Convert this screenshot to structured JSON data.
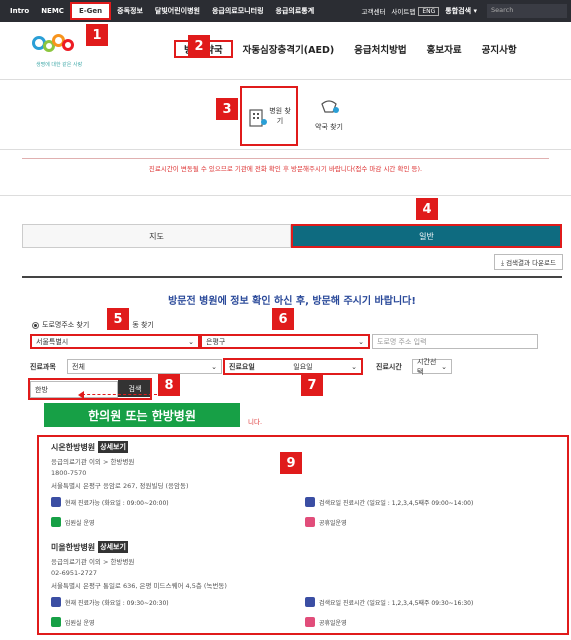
{
  "topbar": {
    "items": [
      "Intro",
      "NEMC",
      "E-Gen",
      "중독정보",
      "달빛어린이병원",
      "응급의료모니터링",
      "응급의료통계"
    ],
    "right": [
      "고객센터",
      "사이트맵"
    ],
    "lang": "ENG",
    "integrated_search": "통합검색 ▾",
    "search_placeholder": "Search"
  },
  "logo": {
    "slogan": "생명에 대한 같은 사랑"
  },
  "nav": {
    "items": [
      "병원.약국",
      "자동심장충격기(AED)",
      "응급처치방법",
      "홍보자료",
      "공지사항"
    ]
  },
  "subtabs": {
    "hospital": "병원 찾기",
    "pharmacy": "약국 찾기"
  },
  "notice": "진료시간이 변동될 수 있으므로 기관에 전화 확인 후 방문해주시기 바랍니다(접수 마감 시간 확인 등).",
  "viewtabs": {
    "map": "지도",
    "general": "일반"
  },
  "download": "⤓ 검색결과 다운로드",
  "filter": {
    "headline": "방문전 병원에 정보 확인 하신 후, 방문해 주시기 바랍니다!",
    "radio_road": "도로명주소 찾기",
    "radio_dong": "동 찾기",
    "city": "서울특별시",
    "district": "은평구",
    "road_placeholder": "도로명 주소 입력",
    "dept_label": "진료과목",
    "dept_value": "전체",
    "day_label": "진료요일",
    "day_value": "일요일",
    "time_label": "진료시간",
    "time_value": "시간선택",
    "keyword": "한방",
    "search_btn": "검색"
  },
  "annotation": {
    "green": "한의원 또는 한방병원",
    "result_note": "니다."
  },
  "badges": [
    "1",
    "2",
    "3",
    "4",
    "5",
    "6",
    "7",
    "8",
    "9"
  ],
  "results": [
    {
      "name": "시온한방병원",
      "detail": "상세보기",
      "type": "응급의료기관 이외 > 한방병원",
      "phone": "1800-7570",
      "address": "서울특별시 은평구 응암로 267, 정원빌딩 (응암동)",
      "status_now": "현재 진료가능 (화요일 : 09:00~20:00)",
      "status_search": "검색요일 진료시간 (일요일 : 1,2,3,4,5째주 09:00~14:00)",
      "er": "입원실 운영",
      "holiday": "공휴일운영"
    },
    {
      "name": "미올한방병원",
      "detail": "상세보기",
      "type": "응급의료기관 이외 > 한방병원",
      "phone": "02-6951-2727",
      "address": "서울특별시 은평구 통일로 636, 은평 미드스퀘어 4,5층 (녹번동)",
      "status_now": "현재 진료가능 (화요일 : 09:30~20:30)",
      "status_search": "검색요일 진료시간 (일요일 : 1,2,3,4,5째주 09:30~16:30)",
      "er": "입원실 운영",
      "holiday": "공휴일운영"
    }
  ],
  "colors": {
    "accent_red": "#e01b1b",
    "teal": "#0e6b80",
    "green": "#17a046",
    "blue_text": "#2b4a9a"
  }
}
